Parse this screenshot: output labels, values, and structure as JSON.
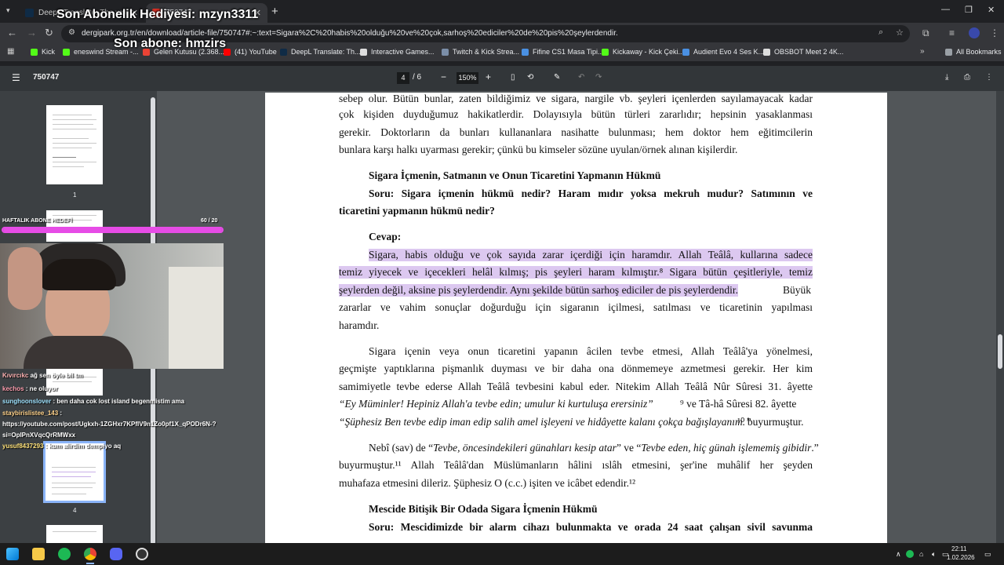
{
  "overlay": {
    "last_sub_gift": "Son Abonelik Hediyesi: mzyn3311",
    "last_sub": "Son abone: hmzirs",
    "goal_label": "HAFTALIK ABONE HEDEFİ",
    "goal_count": "60 / 20",
    "colors": {
      "goal_bar": "#e64ce6"
    }
  },
  "browser": {
    "tabs": [
      {
        "title": "DeepL Translate: The world's m",
        "active": false
      },
      {
        "title": "750747",
        "active": true
      }
    ],
    "url": "dergipark.org.tr/en/download/article-file/750747#:~:text=Sigara%2C%20habis%20olduğu%20ve%20çok,sarhoş%20ediciler%20de%20pis%20şeylerdendir.",
    "bookmarks": [
      "Kick",
      "eneswind Stream -...",
      "Gelen Kutusu (2.368...",
      "(41) YouTube",
      "DeepL Translate: Th...",
      "Interactive Games...",
      "Twitch & Kick Strea...",
      "Fifine CS1 Masa Tipi...",
      "Kickaway - Kick Çeki...",
      "Audient Evo 4 Ses K...",
      "OBSBOT Meet 2 4K..."
    ],
    "all_bookmarks": "All Bookmarks"
  },
  "pdf": {
    "title": "750747",
    "page_current": "4",
    "page_total": "/ 6",
    "zoom": "150%",
    "thumbnails": [
      "1",
      "4"
    ],
    "lines": [
      {
        "t": "sebep olur. Bütün bunlar, zaten bildiğimiz ve sigara, nargile vb. şeyleri içenlerden sayılamayacak kadar"
      },
      {
        "t": "çok kişiden duyduğumuz hakikatlerdir. Dolayısıyla bütün türleri zararlıdır; hepsinin yasaklanması"
      },
      {
        "t": "gerekir. Doktorların da bunları kullananlara nasihatte bulunması; hem doktor hem eğitimcilerin"
      },
      {
        "t": "bunlara karşı halkı uyarması gerekir; çünkü bu kimseler sözüne uyulan/örnek alınan kişilerdir."
      },
      {
        "t": "Sigara İçmenin, Satmanın ve Onun Ticaretini Yapmanın Hükmü"
      },
      {
        "t": "Soru: Sigara içmenin hükmü nedir? Haram mıdır yoksa mekruh mudur? Satımının ve"
      },
      {
        "t": "ticaretini yapmanın hükmü nedir?"
      },
      {
        "t": "Cevap:"
      },
      {
        "t": "Sigara, habis olduğu ve çok sayıda zarar içerdiği için haramdır. Allah Teâlâ, kullarına sadece"
      },
      {
        "t": "temiz yiyecek ve içecekleri helâl kılmış; pis şeyleri haram kılmıştır.⁸ Sigara bütün çeşitleriyle, temiz"
      },
      {
        "t": "şeylerden değil, aksine pis şeylerdendir. Aynı şekilde bütün sarhoş ediciler de pis şeylerdendir."
      },
      {
        "t": "Büyük"
      },
      {
        "t": "zararlar ve vahim sonuçlar doğurduğu için sigaranın içilmesi, satılması ve ticaretinin yapılması"
      },
      {
        "t": "haramdır."
      },
      {
        "t": "Sigara içenin veya onun ticaretini yapanın âcilen tevbe etmesi, Allah Teâlâ'ya yönelmesi,"
      },
      {
        "t": "geçmişte yaptıklarına pişmanlık duyması ve bir daha ona dönmemeye azmetmesi gerekir. Her kim"
      },
      {
        "t": "samimiyetle tevbe ederse Allah Teâlâ tevbesini kabul eder. Nitekim Allah Teâlâ Nûr Sûresi 31. âyette"
      },
      {
        "t": "“Ey Müminler! Hepiniz Allah'a tevbe edin; umulur ki kurtuluşa erersiniz”"
      },
      {
        "t": "⁹ ve Tâ-hâ Sûresi 82. âyette"
      },
      {
        "t": "“Şüphesiz Ben tevbe edip iman edip salih amel işleyeni ve hidâyette kalanı çokça bağışlayanım.”"
      },
      {
        "t": "¹⁰ buyurmuştur."
      },
      {
        "t": "Nebî (sav) de “"
      },
      {
        "t": "Tevbe, öncesindekileri günahları kesip atar"
      },
      {
        "t": "” ve “"
      },
      {
        "t": "Tevbe eden, hiç günah işlememiş gibidir"
      },
      {
        "t": ".”"
      },
      {
        "t": "buyurmuştur.¹¹ Allah Teâlâ'dan Müslümanların hâlini ıslâh etmesini, şer'ine muhâlif her şeyden"
      },
      {
        "t": "muhafaza etmesini dileriz. Şüphesiz O (c.c.) işiten ve icâbet edendir.¹²"
      },
      {
        "t": "Mescide Bitişik Bir Odada Sigara İçmenin Hükmü"
      },
      {
        "t": "Soru: Mescidimizde bir alarm cihazı bulunmakta ve orada 24 saat çalışan sivil savunma"
      }
    ]
  },
  "chat": [
    {
      "user": "Kıvırcıkc",
      "msg": "ağ sen öyle bil tm"
    },
    {
      "user": "kechos",
      "msg": ": ne oluyor"
    },
    {
      "user": "sunghoonslover",
      "msg": ": ben daha cok lost island begenmistim ama"
    },
    {
      "user": "staybirislistee_143",
      "msg": ":"
    },
    {
      "user": "",
      "msg": "https://youtube.com/post/Ugkxh-1ZGHxr7KPfIV9n1Zo0pf1X_qPODr6N-?"
    },
    {
      "user": "",
      "msg": "si=OpIPnXVqcQrRMWxx"
    },
    {
      "user": "yusuf8437293",
      "msg": ": kum alirdim dempiyo aq"
    }
  ],
  "taskbar": {
    "time": "22:11",
    "date": "1.02.2026"
  }
}
